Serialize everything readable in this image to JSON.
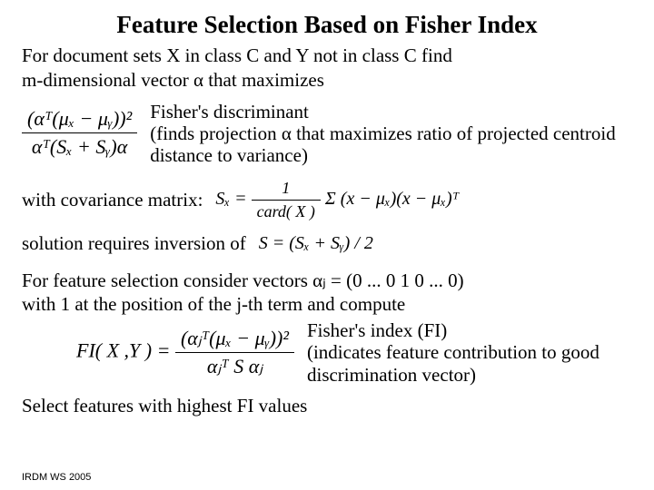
{
  "title": "Feature Selection Based on Fisher Index",
  "intro1": "For document sets X in class C and Y not in class C find",
  "intro2": "m-dimensional vector α that maximizes",
  "formula1": {
    "num": "(αᵀ(μₓ − μᵧ))²",
    "den": "αᵀ(Sₓ + Sᵧ)α"
  },
  "desc1a": "Fisher's discriminant",
  "desc1b": "(finds projection α that maximizes ratio of projected centroid distance to variance)",
  "cov_label": "with covariance matrix:",
  "cov_formula_lhs": "Sₓ =",
  "cov_formula_frac": "1",
  "cov_formula_card": "card( X )",
  "cov_formula_sum": "Σ (x − μₓ)(x − μₓ)ᵀ",
  "inversion": "solution requires inversion of",
  "inv_formula": "S = (Sₓ + Sᵧ) / 2",
  "consider1": "For feature selection consider vectors αⱼ = (0 ... 0 1 0 ... 0)",
  "consider2": "with 1 at the position of the j-th term and compute",
  "formula2_lhs": "FI( X ,Y ) =",
  "formula2": {
    "num": "(αⱼᵀ(μₓ − μᵧ))²",
    "den": "αⱼᵀ S αⱼ"
  },
  "desc2a": "Fisher's index (FI)",
  "desc2b": "(indicates feature contribution to good discrimination vector)",
  "select": "Select features with highest FI values",
  "footer": "IRDM  WS 2005"
}
